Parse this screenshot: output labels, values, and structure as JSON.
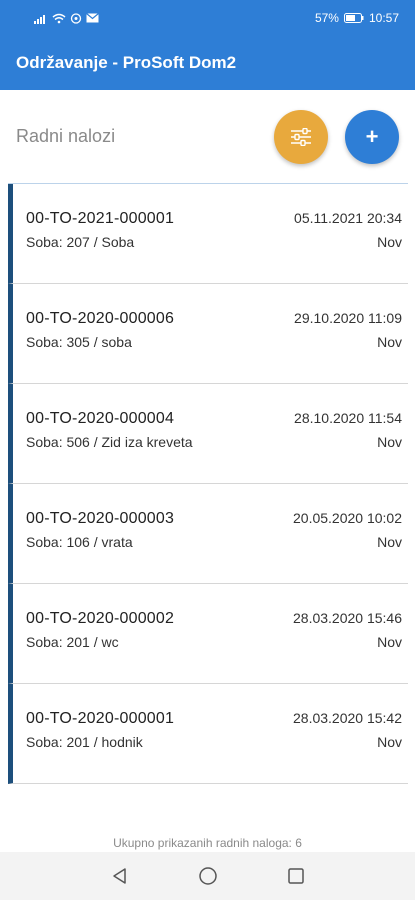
{
  "status_bar": {
    "battery": "57%",
    "time": "10:57",
    "icons": [
      "signal-icon",
      "wifi-icon",
      "nfc-icon",
      "mail-icon",
      "battery-icon"
    ]
  },
  "app_bar": {
    "title": "Održavanje - ProSoft Dom2"
  },
  "toolbar": {
    "title": "Radni nalozi",
    "filter_icon": "sliders-icon",
    "add_label": "+"
  },
  "work_orders": [
    {
      "number": "00-TO-2021-000001",
      "date": "05.11.2021 20:34",
      "location": "Soba: 207 / Soba",
      "status": "Nov"
    },
    {
      "number": "00-TO-2020-000006",
      "date": "29.10.2020 11:09",
      "location": "Soba: 305 / soba",
      "status": "Nov"
    },
    {
      "number": "00-TO-2020-000004",
      "date": "28.10.2020 11:54",
      "location": "Soba: 506 / Zid iza kreveta",
      "status": "Nov"
    },
    {
      "number": "00-TO-2020-000003",
      "date": "20.05.2020 10:02",
      "location": "Soba: 106 / vrata",
      "status": "Nov"
    },
    {
      "number": "00-TO-2020-000002",
      "date": "28.03.2020 15:46",
      "location": "Soba: 201 / wc",
      "status": "Nov"
    },
    {
      "number": "00-TO-2020-000001",
      "date": "28.03.2020 15:42",
      "location": "Soba: 201 / hodnik",
      "status": "Nov"
    }
  ],
  "footer": {
    "summary": "Ukupno prikazanih radnih naloga: 6"
  },
  "colors": {
    "primary": "#2e7ed6",
    "accent": "#e8a93d",
    "item_marker": "#1d4f7c"
  }
}
